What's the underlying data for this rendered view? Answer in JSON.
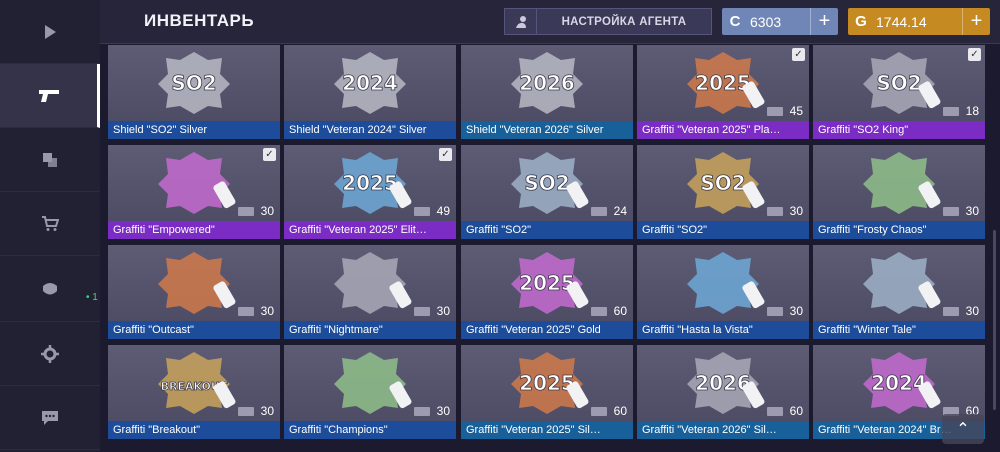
{
  "header": {
    "title": "ИНВЕНТАРЬ",
    "agent_button": "НАСТРОЙКА АГЕНТА",
    "silver": {
      "symbol": "C",
      "amount": "6303"
    },
    "gold": {
      "symbol": "G",
      "amount": "1744.14"
    },
    "plus": "+"
  },
  "sidebar": {
    "items": [
      {
        "icon": "play-icon"
      },
      {
        "icon": "pistol-icon",
        "active": true
      },
      {
        "icon": "cases-icon"
      },
      {
        "icon": "cart-icon"
      },
      {
        "icon": "mask-icon",
        "count": "• 1"
      },
      {
        "icon": "gear-icon"
      },
      {
        "icon": "chat-icon"
      }
    ]
  },
  "items": [
    {
      "name": "Shield \"SO2\" Silver",
      "label": "SO2",
      "type": "shield",
      "color": "blue",
      "checked": false,
      "qty": ""
    },
    {
      "name": "Shield \"Veteran 2024\" Silver",
      "label": "2024",
      "type": "shield",
      "color": "blue",
      "checked": false,
      "qty": ""
    },
    {
      "name": "Shield \"Veteran 2026\" Silver",
      "label": "2026",
      "type": "shield",
      "color": "teal",
      "checked": false,
      "qty": ""
    },
    {
      "name": "Graffiti \"Veteran 2025\" Pla…",
      "label": "2025",
      "type": "graffiti",
      "color": "purple",
      "checked": true,
      "qty": "45"
    },
    {
      "name": "Graffiti \"SO2 King\"",
      "label": "SO2",
      "type": "graffiti",
      "color": "purple",
      "checked": true,
      "qty": "18"
    },
    {
      "name": "Graffiti \"Empowered\"",
      "label": "",
      "type": "graffiti",
      "color": "purple",
      "checked": true,
      "qty": "30"
    },
    {
      "name": "Graffiti \"Veteran 2025\" Elit…",
      "label": "2025",
      "type": "graffiti",
      "color": "purple",
      "checked": true,
      "qty": "49"
    },
    {
      "name": "Graffiti \"SO2\"",
      "label": "SO2",
      "type": "graffiti",
      "color": "blue",
      "checked": false,
      "qty": "24"
    },
    {
      "name": "Graffiti \"SO2\"",
      "label": "SO2",
      "type": "graffiti",
      "color": "blue",
      "checked": false,
      "qty": "30"
    },
    {
      "name": "Graffiti \"Frosty Chaos\"",
      "label": "",
      "type": "graffiti",
      "color": "blue",
      "checked": false,
      "qty": "30"
    },
    {
      "name": "Graffiti \"Outcast\"",
      "label": "",
      "type": "graffiti",
      "color": "blue",
      "checked": false,
      "qty": "30"
    },
    {
      "name": "Graffiti \"Nightmare\"",
      "label": "",
      "type": "graffiti",
      "color": "blue",
      "checked": false,
      "qty": "30"
    },
    {
      "name": "Graffiti \"Veteran 2025\" Gold",
      "label": "2025",
      "type": "graffiti",
      "color": "blue",
      "checked": false,
      "qty": "60"
    },
    {
      "name": "Graffiti \"Hasta la Vista\"",
      "label": "",
      "type": "graffiti",
      "color": "blue",
      "checked": false,
      "qty": "30"
    },
    {
      "name": "Graffiti \"Winter Tale\"",
      "label": "",
      "type": "graffiti",
      "color": "blue",
      "checked": false,
      "qty": "30"
    },
    {
      "name": "Graffiti \"Breakout\"",
      "label": "BREAKOUT",
      "type": "graffiti",
      "color": "blue",
      "checked": false,
      "qty": "30"
    },
    {
      "name": "Graffiti \"Champions\"",
      "label": "",
      "type": "graffiti",
      "color": "blue",
      "checked": false,
      "qty": "30"
    },
    {
      "name": "Graffiti \"Veteran 2025\" Sil…",
      "label": "2025",
      "type": "graffiti",
      "color": "teal",
      "checked": false,
      "qty": "60"
    },
    {
      "name": "Graffiti \"Veteran 2026\" Sil…",
      "label": "2026",
      "type": "graffiti",
      "color": "teal",
      "checked": false,
      "qty": "60"
    },
    {
      "name": "Graffiti \"Veteran 2024\" Br…",
      "label": "2024",
      "type": "graffiti",
      "color": "teal",
      "checked": false,
      "qty": "60"
    }
  ],
  "scroll_up": "⌃"
}
